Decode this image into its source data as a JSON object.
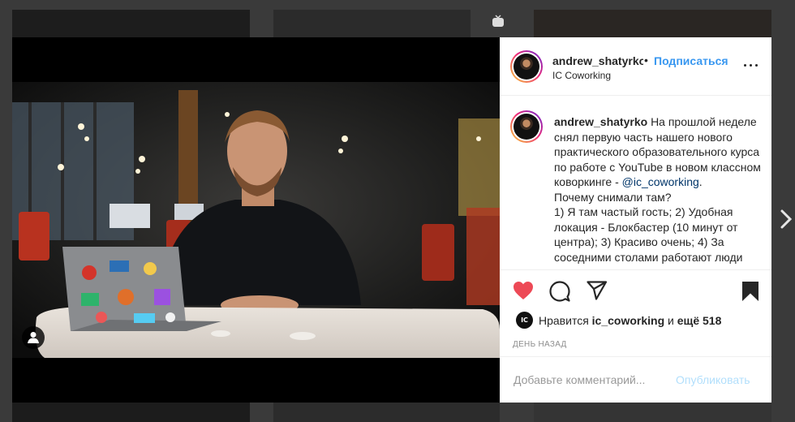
{
  "post": {
    "username": "andrew_shatyrko",
    "separator": "•",
    "follow_label": "Подписаться",
    "location": "IC Coworking",
    "caption": {
      "username": "andrew_shatyrko",
      "text_part1": "На прошлой неделе снял первую часть нашего нового практического образовательного курса по работе с YouTube в новом классном коворкинге -",
      "mention": "@ic_coworking",
      "text_part2": ".",
      "line2": "Почему снимали там?",
      "line3": "1) Я там частый гость; 2) Удобная локация - Блокбастер (10 минут от центра); 3) Красиво очень; 4) За соседними столами работают люди"
    },
    "likes": {
      "avatar_text": "IC",
      "prefix": "Нравится",
      "user": "ic_coworking",
      "connector": "и",
      "count_text": "ещё 518"
    },
    "timestamp": "ДЕНЬ НАЗАД",
    "comment_placeholder": "Добавьте комментарий...",
    "publish_label": "Опубликовать"
  },
  "icons": {
    "like": "heart-icon-filled",
    "comment": "comment-icon",
    "share": "share-icon",
    "save": "bookmark-icon-filled",
    "more": "more-icon",
    "tag": "user-tag-icon",
    "next": "chevron-right-icon",
    "igtv": "igtv-icon"
  },
  "colors": {
    "accent": "#3897f0",
    "like": "#ed4956",
    "publish_disabled": "#b2dffc",
    "mention": "#003569"
  }
}
